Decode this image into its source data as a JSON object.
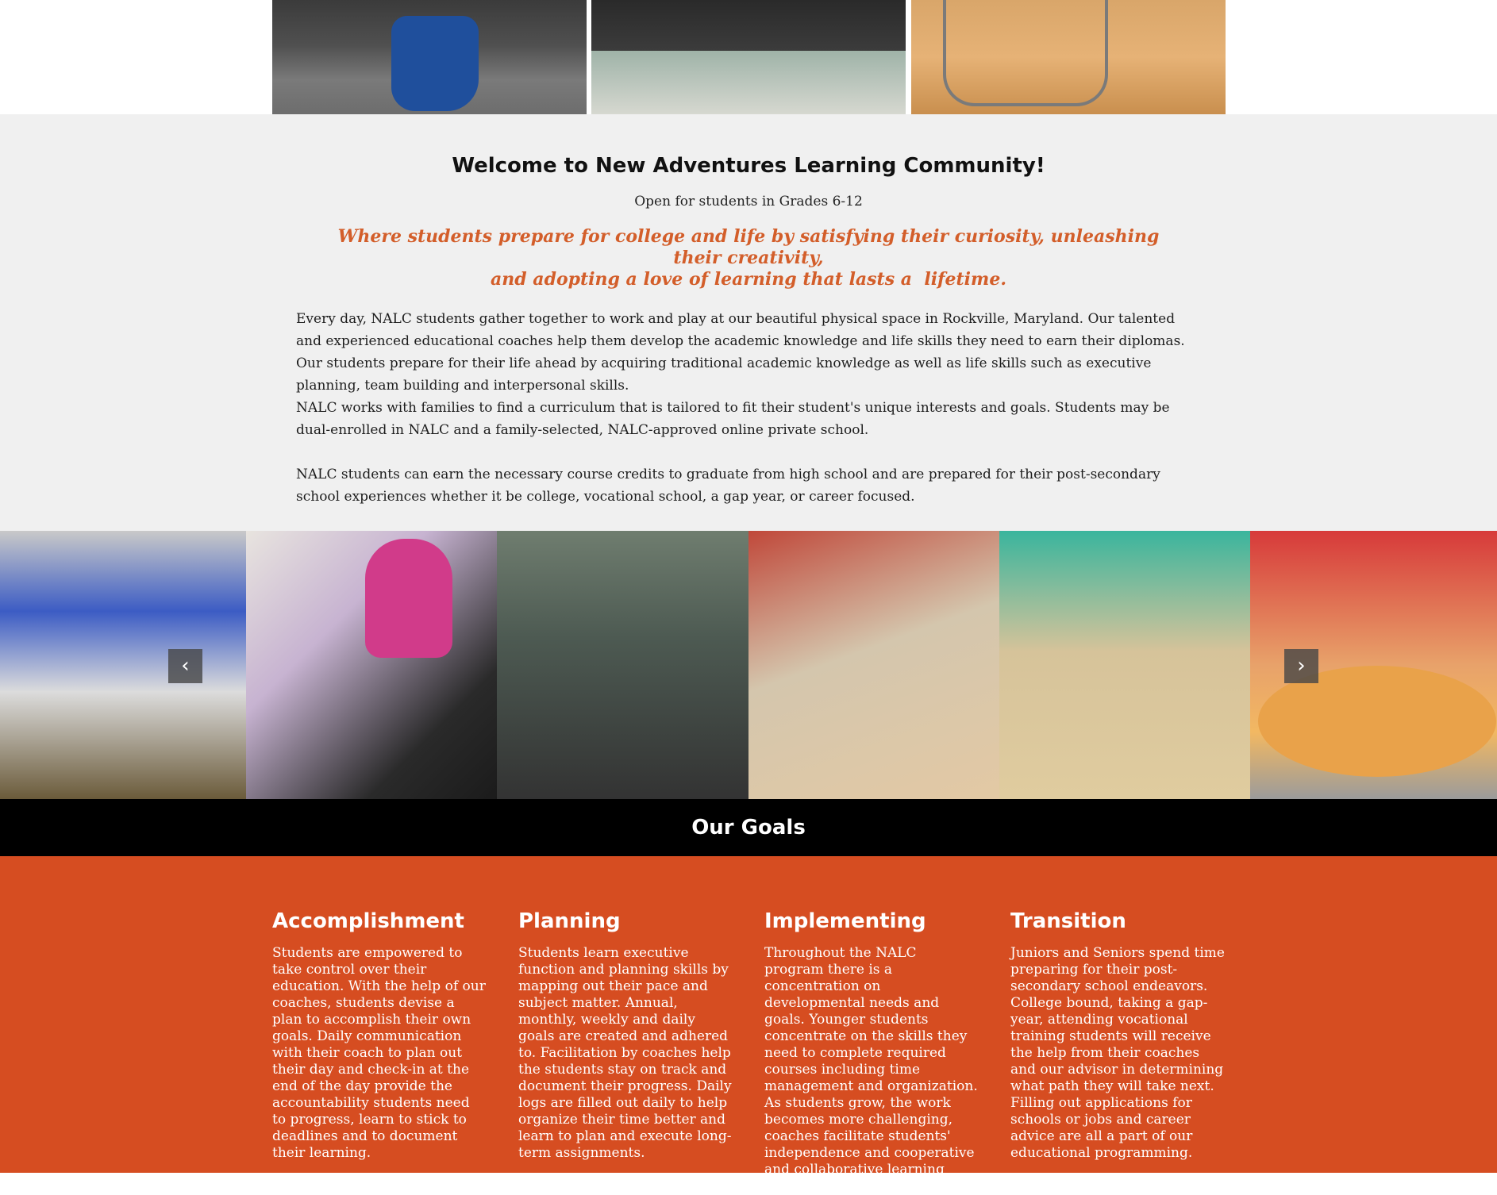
{
  "welcome": {
    "title": "Welcome to New Adventures Learning Community!",
    "subtitle": "Open for students in Grades 6-12",
    "tagline_line1": "Where students prepare for college and life by satisfying their curiosity, unleashing their creativity,",
    "tagline_line2": "and adopting a love of learning that lasts a  lifetime.",
    "paragraph1": "Every day, NALC students gather together to work and play at our beautiful physical space in Rockville, Maryland. Our talented and experienced educational coaches help them develop the academic knowledge and life skills they need to earn their diplomas. Our students prepare for their life ahead by acquiring traditional academic knowledge as well as life skills such as executive planning, team building and interpersonal skills.",
    "paragraph2": "NALC works with families to find a curriculum that is tailored to fit their student's unique interests and goals. Students may be dual-enrolled in NALC and a family-selected, NALC-approved online private school.",
    "paragraph3": "NALC students can earn the necessary course credits to graduate from high school and are prepared for their post-secondary school experiences whether it be college, vocational school, a gap year, or career focused."
  },
  "carousel": {
    "prev_icon": "‹",
    "next_icon": "›"
  },
  "goals": {
    "heading": "Our Goals",
    "items": [
      {
        "title": "Accomplishment",
        "text": "Students are empowered to take control over their education.  With the help of our coaches, students devise a plan to accomplish their own goals.  Daily communication with their coach to plan out their day and check-in at the end of the day provide the accountability students need to progress, learn to stick to deadlines and to document their learning."
      },
      {
        "title": "Planning",
        "text": "Students learn executive function and planning skills by mapping out their pace and subject matter. Annual, monthly, weekly and daily goals are created and adhered to.  Facilitation by coaches help the students stay on track and document their progress.   Daily logs are filled out daily to help organize their time better and learn to plan and execute long-term assignments."
      },
      {
        "title": "Implementing",
        "text": "Throughout the NALC program there is a concentration on developmental needs and goals. Younger students concentrate on the skills they need to complete required courses including time management and organization. As students grow, the work becomes more challenging, coaches facilitate students' independence and cooperative and collaborative learning skills to complete high school."
      },
      {
        "title": "Transition",
        "text": "Juniors and Seniors spend time preparing for their post-secondary school endeavors.  College bound, taking a gap-year, attending vocational training students will receive the help from their coaches and our advisor in determining what path they will take next.  Filling out applications for schools or jobs and career advice are all a part of our educational programming."
      }
    ]
  }
}
